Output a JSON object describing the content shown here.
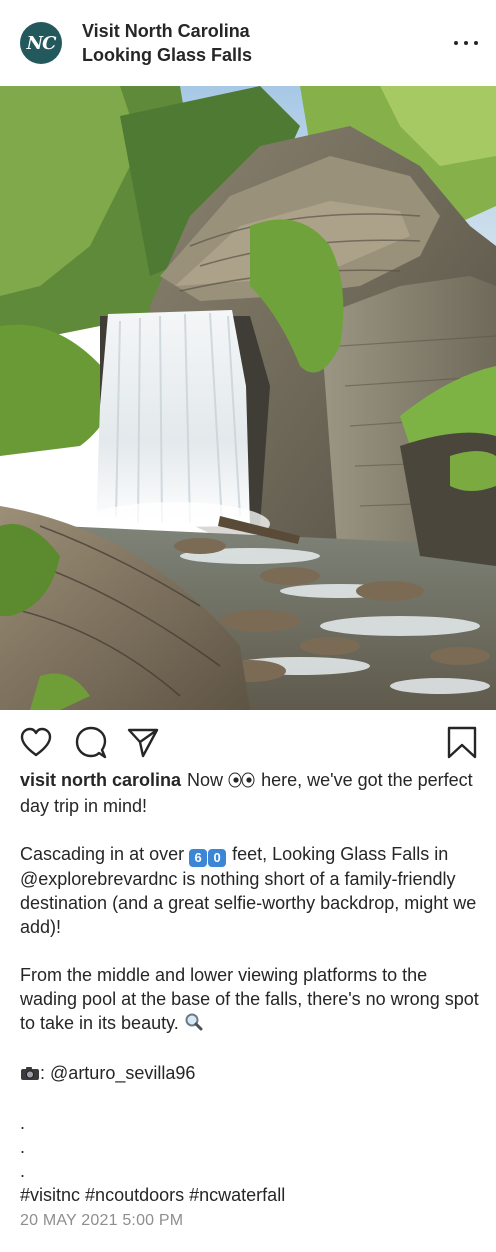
{
  "header": {
    "avatar_text": "NC",
    "account_name": "Visit North Carolina",
    "location": "Looking Glass Falls"
  },
  "photo": {
    "subject": "waterfall-image"
  },
  "actions": {
    "like_icon": "heart-icon",
    "comment_icon": "comment-icon",
    "share_icon": "paper-plane-icon",
    "save_icon": "bookmark-icon"
  },
  "caption": {
    "username": "visit north carolina",
    "line1_before": "Now",
    "line1_after": "here, we've got the perfect day trip in mind!",
    "p2_before": "Cascading in at over",
    "digit_6": "6",
    "digit_0": "0",
    "p2_mid": "feet, Looking Glass Falls in",
    "mention_1": "@explorebrevardnc",
    "p2_after": "is nothing short of a family-friendly destination (and a great selfie-worthy backdrop, might we add)!",
    "p3": "From the middle and lower viewing platforms to the wading pool at the base of the falls, there's no wrong spot to take in its beauty.",
    "credit_sep": ":",
    "mention_2": "@arturo_sevilla96",
    "dots": [
      ".",
      ".",
      "."
    ],
    "hashtags": [
      "#visitnc",
      "#ncoutdoors",
      "#ncwaterfall"
    ]
  },
  "timestamp": "20 MAY 2021 5:00 PM",
  "colors": {
    "avatar_bg": "#23595c",
    "text": "#262626",
    "muted": "#8e8e8e",
    "keycap": "#3b87d6"
  }
}
